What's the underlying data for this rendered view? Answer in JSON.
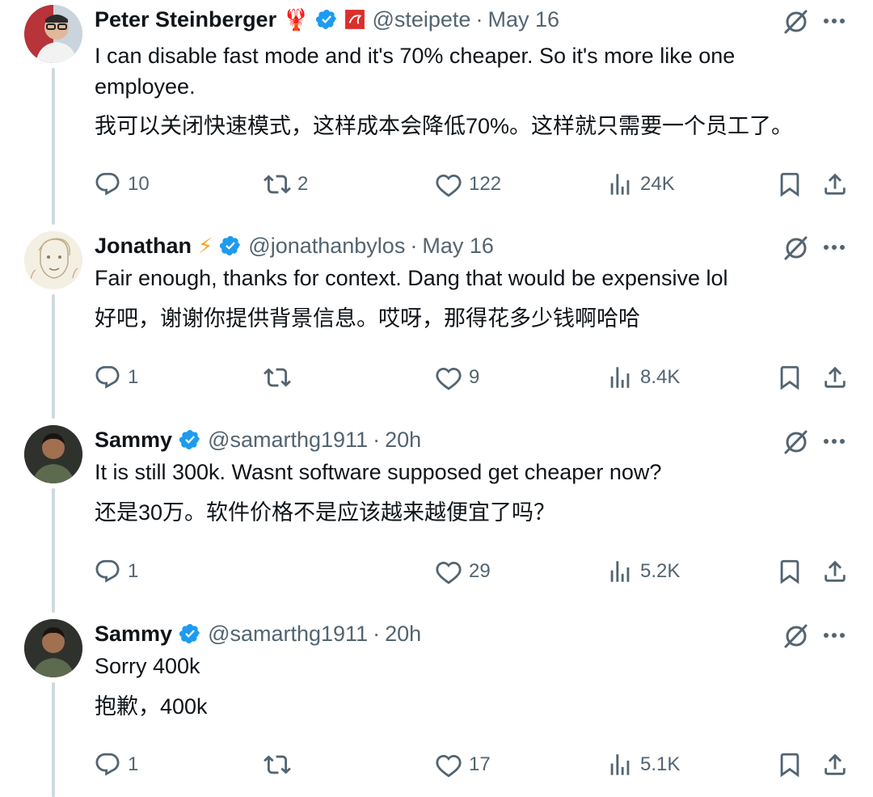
{
  "colors": {
    "verified": "#1d9bf0",
    "text": "#0f1419",
    "muted": "#536471",
    "thread": "#cfd9de"
  },
  "icons": {
    "reply": "speech-bubble-icon",
    "retweet": "retweet-arrows-icon",
    "like": "heart-outline-icon",
    "views": "bar-chart-icon",
    "bookmark": "bookmark-icon",
    "share": "share-upload-icon",
    "grok": "grok-slash-circle-icon",
    "more": "ellipsis-icon"
  },
  "tweets": [
    {
      "name": "Peter Steinberger",
      "badges": "🦞",
      "handle": "@steipete",
      "dot": "·",
      "date": "May 16",
      "text_en": "I can disable fast mode and it's 70% cheaper. So it's more like one employee.",
      "text_zh": "我可以关闭快速模式，这样成本会降低70%。这样就只需要一个员工了。",
      "replies": "10",
      "retweets": "2",
      "likes": "122",
      "views": "24K"
    },
    {
      "name": "Jonathan",
      "badges": "⚡",
      "handle": "@jonathanbylos",
      "dot": "·",
      "date": "May 16",
      "text_en": "Fair enough, thanks for context. Dang that would be expensive lol",
      "text_zh": "好吧，谢谢你提供背景信息。哎呀，那得花多少钱啊哈哈",
      "replies": "1",
      "retweets": "",
      "likes": "9",
      "views": "8.4K"
    },
    {
      "name": "Sammy",
      "badges": "",
      "handle": "@samarthg1911",
      "dot": "·",
      "date": "20h",
      "text_en": "It is still 300k. Wasnt software supposed get cheaper now?",
      "text_zh": "还是30万。软件价格不是应该越来越便宜了吗？",
      "replies": "1",
      "retweets": "",
      "likes": "29",
      "views": "5.2K"
    },
    {
      "name": "Sammy",
      "badges": "",
      "handle": "@samarthg1911",
      "dot": "·",
      "date": "20h",
      "text_en": "Sorry 400k",
      "text_zh": "抱歉，400k",
      "replies": "1",
      "retweets": "",
      "likes": "17",
      "views": "5.1K"
    }
  ]
}
